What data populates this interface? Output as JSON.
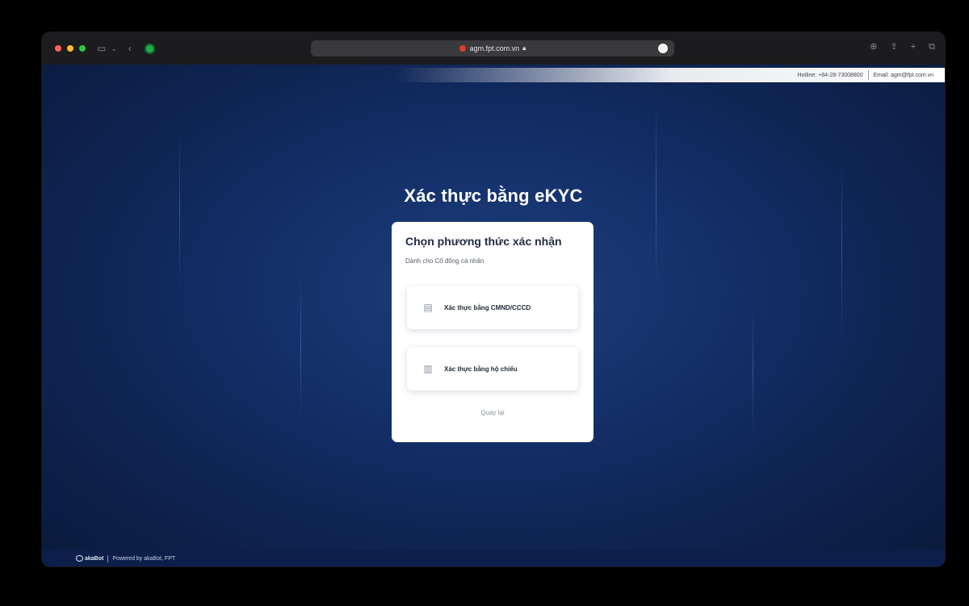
{
  "browser": {
    "url": "agm.fpt.com.vn",
    "icons": {
      "sidebar": "sidebar-icon",
      "back": "back-icon",
      "extension": "extension-icon",
      "reader": "reader-icon",
      "download": "download-icon",
      "share": "share-icon",
      "new_tab": "plus-icon",
      "tabs": "tabs-icon",
      "lock": "lock-icon"
    }
  },
  "top_bar": {
    "hotline": "Hotline: +84-28-73008800",
    "email": "Email: agm@fpt.com.vn"
  },
  "page": {
    "title": "Xác thực bằng eKYC"
  },
  "card": {
    "title": "Chọn phương thức xác nhận",
    "subtitle": "Dành cho Cổ đông cá nhân",
    "options": [
      {
        "label": "Xác thực bằng CMND/CCCD",
        "icon": "id-card-icon"
      },
      {
        "label": "Xác thực bằng hộ chiếu",
        "icon": "passport-icon"
      }
    ],
    "back_label": "Quay lại"
  },
  "footer": {
    "logo": "akaBot",
    "powered_by": "Powered by akaBot, FPT"
  },
  "colors": {
    "background": "#14306a",
    "card": "#ffffff",
    "heading": "#ffffff"
  }
}
